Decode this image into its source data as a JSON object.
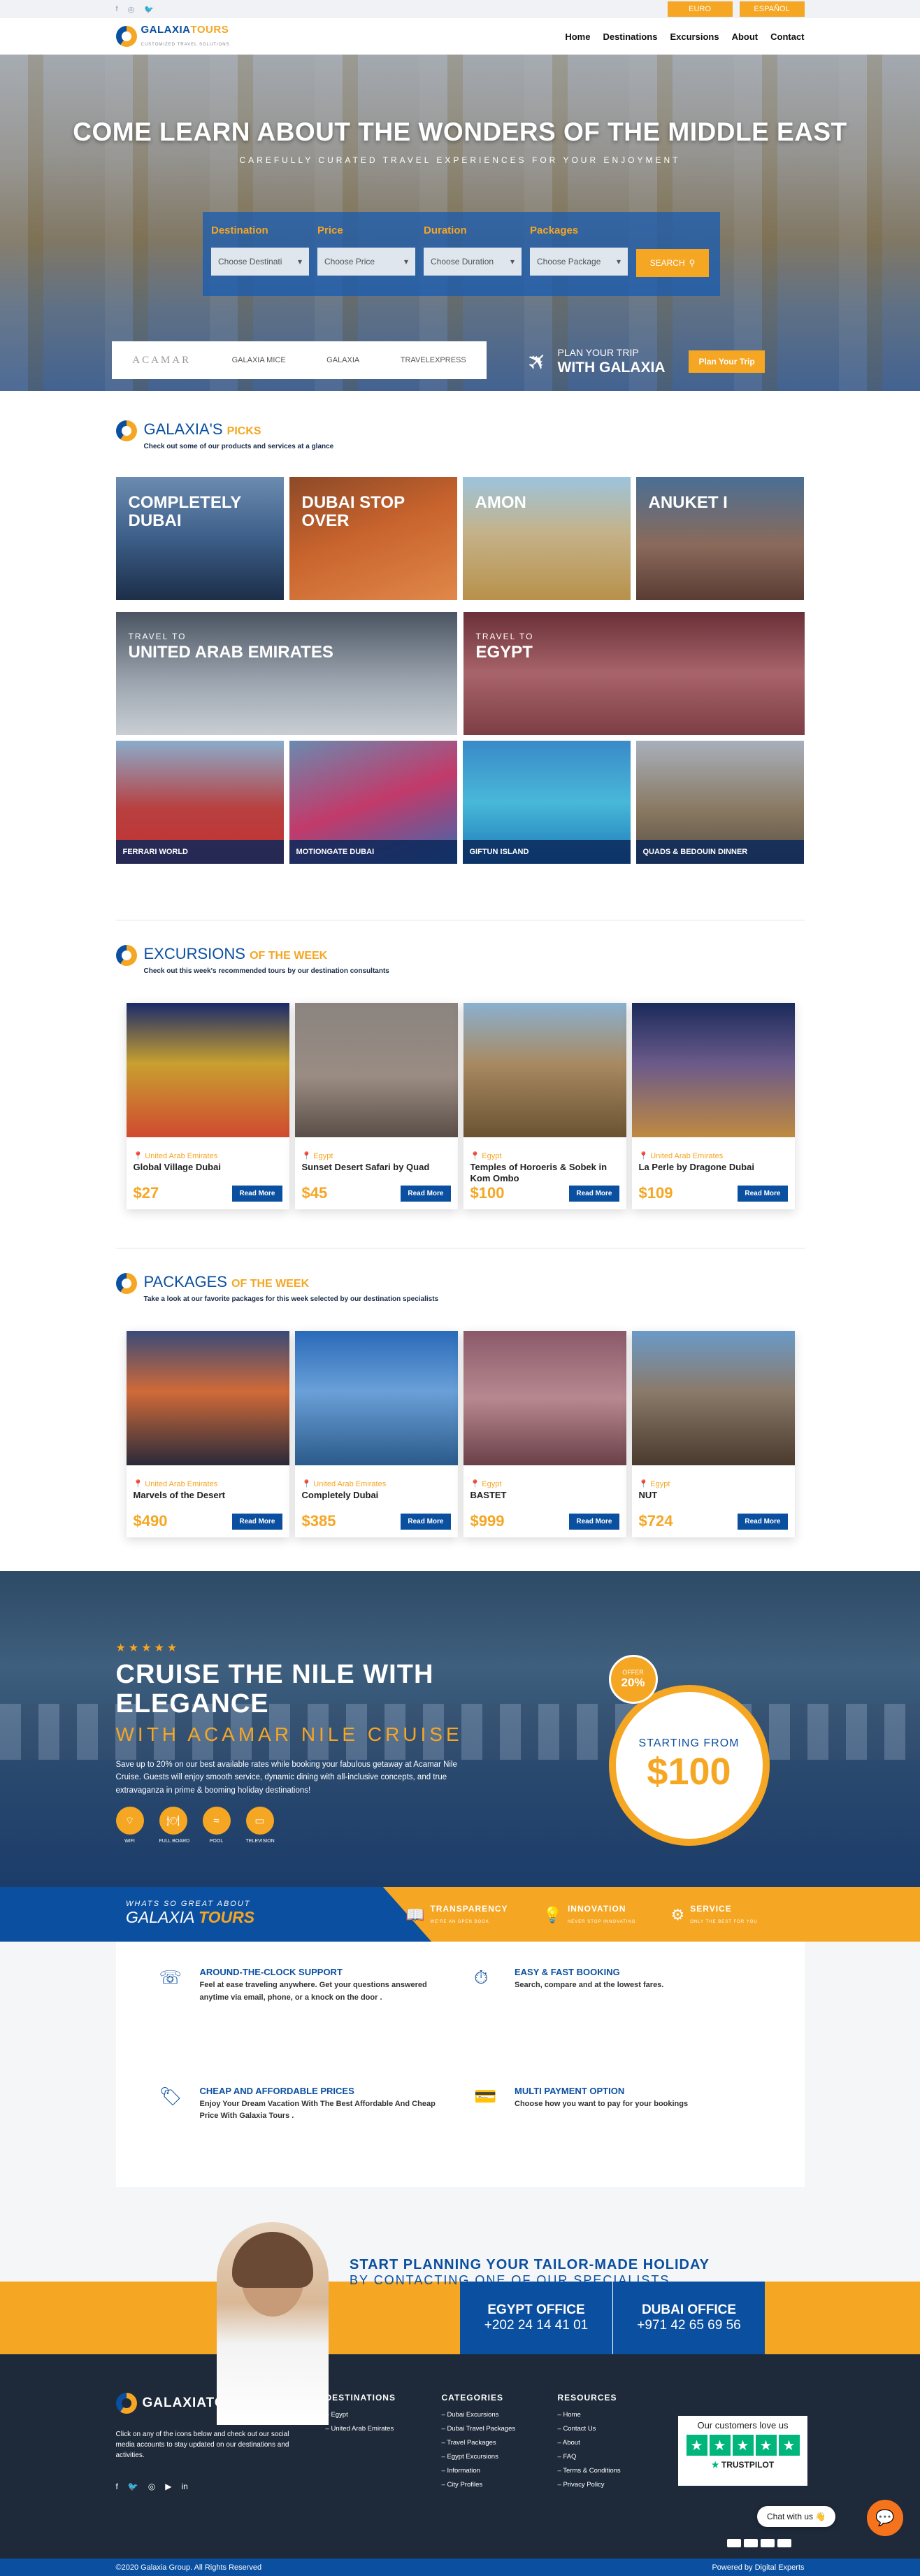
{
  "topbar": {
    "social": [
      "facebook-icon",
      "instagram-icon",
      "twitter-icon"
    ],
    "languages": [
      "EURO",
      "ESPAÑOL"
    ]
  },
  "header": {
    "logo": {
      "name_a": "GALAXIA",
      "name_b": "TOURS",
      "tagline": "CUSTOMIZED TRAVEL SOLUTIONS"
    },
    "nav": [
      "Home",
      "Destinations",
      "Excursions",
      "About",
      "Contact"
    ]
  },
  "hero": {
    "title": "COME LEARN ABOUT THE WONDERS OF THE MIDDLE EAST",
    "subtitle": "CAREFULLY CURATED TRAVEL EXPERIENCES FOR YOUR ENJOYMENT",
    "search": {
      "fields": [
        {
          "label": "Destination",
          "value": "Choose Destinati"
        },
        {
          "label": "Price",
          "value": "Choose Price"
        },
        {
          "label": "Duration",
          "value": "Choose Duration"
        },
        {
          "label": "Packages",
          "value": "Choose Package"
        }
      ],
      "button": "SEARCH"
    },
    "partners": [
      "ACAMAR",
      "GALAXIA MICE",
      "GALAXIA",
      "TRAVELEXPRESS"
    ],
    "plan": {
      "line1": "PLAN YOUR TRIP",
      "line2": "WITH GALAXIA",
      "button": "Plan Your Trip"
    }
  },
  "picks": {
    "title": "GALAXIA'S",
    "title_accent": "PICKS",
    "desc": "Check out some of our products and services at a glance",
    "top": [
      "COMPLETELY DUBAI",
      "DUBAI STOP OVER",
      "AMON",
      "ANUKET I"
    ],
    "mid": [
      {
        "small": "TRAVEL TO",
        "big": "UNITED ARAB EMIRATES"
      },
      {
        "small": "TRAVEL TO",
        "big": "EGYPT"
      }
    ],
    "bottom": [
      "FERRARI WORLD",
      "MOTIONGATE DUBAI",
      "GIFTUN ISLAND",
      "QUADS & BEDOUIN DINNER"
    ]
  },
  "excursions": {
    "title": "EXCURSIONS",
    "title_accent": "OF THE WEEK",
    "desc": "Check out this week's recommended tours by our destination consultants",
    "read_more": "Read More",
    "items": [
      {
        "location": "United Arab Emirates",
        "name": "Global Village Dubai",
        "price": "$27"
      },
      {
        "location": "Egypt",
        "name": "Sunset Desert Safari by Quad",
        "price": "$45"
      },
      {
        "location": "Egypt",
        "name": "Temples of Horoeris & Sobek in Kom Ombo",
        "price": "$100"
      },
      {
        "location": "United Arab Emirates",
        "name": "La Perle by Dragone Dubai",
        "price": "$109"
      }
    ]
  },
  "packages": {
    "title": "PACKAGES",
    "title_accent": "OF THE WEEK",
    "desc": "Take a look at our favorite packages for this week selected by our destination specialists",
    "read_more": "Read More",
    "items": [
      {
        "location": "United Arab Emirates",
        "name": "Marvels of the Desert",
        "price": "$490"
      },
      {
        "location": "United Arab Emirates",
        "name": "Completely Dubai",
        "price": "$385"
      },
      {
        "location": "Egypt",
        "name": "BASTET",
        "price": "$999"
      },
      {
        "location": "Egypt",
        "name": "NUT",
        "price": "$724"
      }
    ]
  },
  "cruise": {
    "stars": "★★★★★",
    "title": "CRUISE THE NILE WITH ELEGANCE",
    "subtitle": "WITH ACAMAR NILE CRUISE",
    "desc": "Save up to 20% on our best available rates while booking your fabulous getaway at Acamar Nile Cruise. Guests will enjoy smooth service, dynamic dining with all-inclusive concepts, and true extravaganza in prime & booming holiday destinations!",
    "amenities": [
      "WIFI",
      "FULL BOARD",
      "POOL",
      "TELEVISION"
    ],
    "offer_label": "OFFER",
    "offer_value": "20%",
    "starting_label": "STARTING FROM",
    "starting_price": "$100"
  },
  "band": {
    "small": "WHATS SO GREAT ABOUT",
    "big_a": "GALAXIA",
    "big_b": "TOURS",
    "items": [
      {
        "title": "TRANSPARENCY",
        "sub": "WE'RE AN OPEN BOOK",
        "icon": "book-icon"
      },
      {
        "title": "INNOVATION",
        "sub": "NEVER STOP INNOVATING",
        "icon": "bulb-icon"
      },
      {
        "title": "SERVICE",
        "sub": "ONLY THE BEST FOR YOU",
        "icon": "gears-icon"
      }
    ]
  },
  "features": [
    {
      "title": "AROUND-THE-CLOCK SUPPORT",
      "desc": "Feel at ease traveling anywhere. Get your questions answered anytime via email, phone, or a knock on the door .",
      "icon": "support-icon"
    },
    {
      "title": "EASY & FAST BOOKING",
      "desc": "Search, compare and at the lowest fares.",
      "icon": "timer-icon"
    },
    {
      "title": "CHEAP AND AFFORDABLE PRICES",
      "desc": "Enjoy Your Dream Vacation With The Best Affordable And Cheap Price With Galaxia Tours .",
      "icon": "price-icon"
    },
    {
      "title": "MULTI PAYMENT OPTION",
      "desc": "Choose how you want to pay for your bookings",
      "icon": "payment-icon"
    }
  ],
  "contact": {
    "line1": "START PLANNING YOUR TAILOR-MADE HOLIDAY",
    "line2": "BY CONTACTING ONE OF OUR SPECIALISTS...",
    "offices": [
      {
        "name": "EGYPT OFFICE",
        "phone": "+202 24 14 41 01"
      },
      {
        "name": "DUBAI OFFICE",
        "phone": "+971 42 65 69 56"
      }
    ]
  },
  "footer": {
    "logo": "GALAXIATOURS",
    "about": "Click on any of the icons below and check out our social media accounts to stay updated on our destinations and activities.",
    "social": [
      "facebook-icon",
      "twitter-icon",
      "instagram-icon",
      "youtube-icon",
      "linkedin-icon"
    ],
    "columns": [
      {
        "title": "DESTINATIONS",
        "items": [
          "Egypt",
          "United Arab Emirates"
        ]
      },
      {
        "title": "CATEGORIES",
        "items": [
          "Dubai Excursions",
          "Dubai Travel Packages",
          "Travel Packages",
          "Egypt Excursions",
          "Information",
          "City Profiles"
        ]
      },
      {
        "title": "RESOURCES",
        "items": [
          "Home",
          "Contact Us",
          "About",
          "FAQ",
          "Terms & Conditions",
          "Privacy Policy"
        ]
      }
    ],
    "trust": {
      "head": "Our customers love us",
      "brand": "TRUSTPILOT"
    },
    "chat": "Chat with us 👋",
    "copyright": "©2020 Galaxia Group. All Rights Reserved",
    "powered": "Powered by Digital Experts"
  }
}
